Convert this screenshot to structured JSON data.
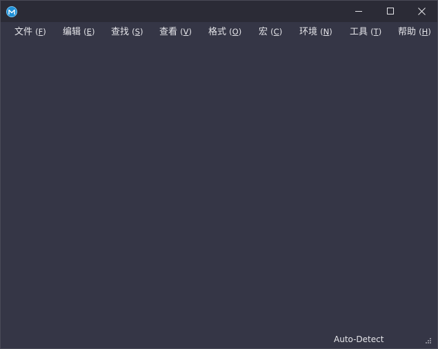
{
  "window": {
    "title": "",
    "app_icon": "M",
    "controls": {
      "minimize": "minimize-icon",
      "maximize": "maximize-icon",
      "close": "close-icon"
    }
  },
  "menubar": {
    "items": [
      {
        "label": "文件",
        "mnemonic": "F"
      },
      {
        "label": "编辑",
        "mnemonic": "E"
      },
      {
        "label": "查找",
        "mnemonic": "S"
      },
      {
        "label": "查看",
        "mnemonic": "V"
      },
      {
        "label": "格式",
        "mnemonic": "O"
      },
      {
        "label": "宏",
        "mnemonic": "C"
      },
      {
        "label": "环境",
        "mnemonic": "N"
      },
      {
        "label": "工具",
        "mnemonic": "T"
      },
      {
        "label": "帮助",
        "mnemonic": "H"
      }
    ]
  },
  "statusbar": {
    "encoding": "Auto-Detect",
    "resize_grip": "resize-grip-icon"
  },
  "colors": {
    "titlebar_bg": "#2b2b36",
    "body_bg": "#353646",
    "text": "#e6e6ea",
    "icon_accent": "#1e8fd6"
  }
}
